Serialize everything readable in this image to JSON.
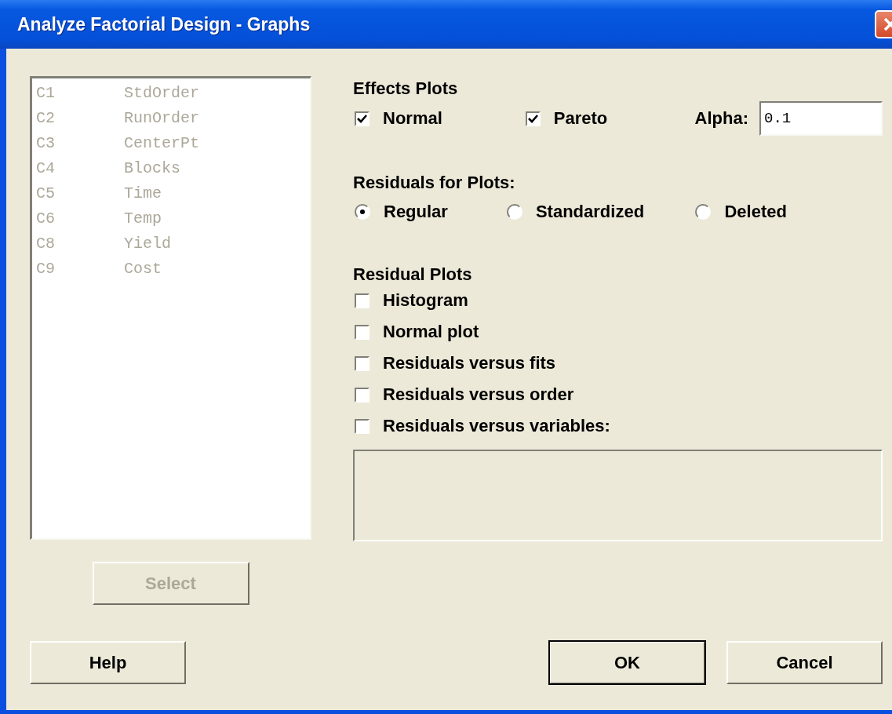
{
  "window": {
    "title": "Analyze Factorial Design - Graphs"
  },
  "variable_list": {
    "disabled": true,
    "items": [
      {
        "column": "C1",
        "name": "StdOrder"
      },
      {
        "column": "C2",
        "name": "RunOrder"
      },
      {
        "column": "C3",
        "name": "CenterPt"
      },
      {
        "column": "C4",
        "name": "Blocks"
      },
      {
        "column": "C5",
        "name": "Time"
      },
      {
        "column": "C6",
        "name": "Temp"
      },
      {
        "column": "C8",
        "name": "Yield"
      },
      {
        "column": "C9",
        "name": "Cost"
      }
    ]
  },
  "select_button": {
    "label": "Select",
    "disabled": true
  },
  "effects_plots": {
    "title": "Effects Plots",
    "options": [
      {
        "label": "Normal",
        "checked": true
      },
      {
        "label": "Pareto",
        "checked": true
      }
    ],
    "alpha": {
      "label": "Alpha:",
      "value": "0.1"
    }
  },
  "residuals_for_plots": {
    "title": "Residuals for Plots:",
    "options": [
      {
        "label": "Regular",
        "selected": true
      },
      {
        "label": "Standardized",
        "selected": false
      },
      {
        "label": "Deleted",
        "selected": false
      }
    ]
  },
  "residual_plots": {
    "title": "Residual Plots",
    "options": [
      {
        "label": "Histogram",
        "checked": false
      },
      {
        "label": "Normal plot",
        "checked": false
      },
      {
        "label": "Residuals versus fits",
        "checked": false
      },
      {
        "label": "Residuals versus order",
        "checked": false
      },
      {
        "label": "Residuals versus variables:",
        "checked": false
      }
    ]
  },
  "buttons": [
    {
      "label": "Help",
      "default": false
    },
    {
      "label": "OK",
      "default": true
    },
    {
      "label": "Cancel",
      "default": false
    }
  ]
}
